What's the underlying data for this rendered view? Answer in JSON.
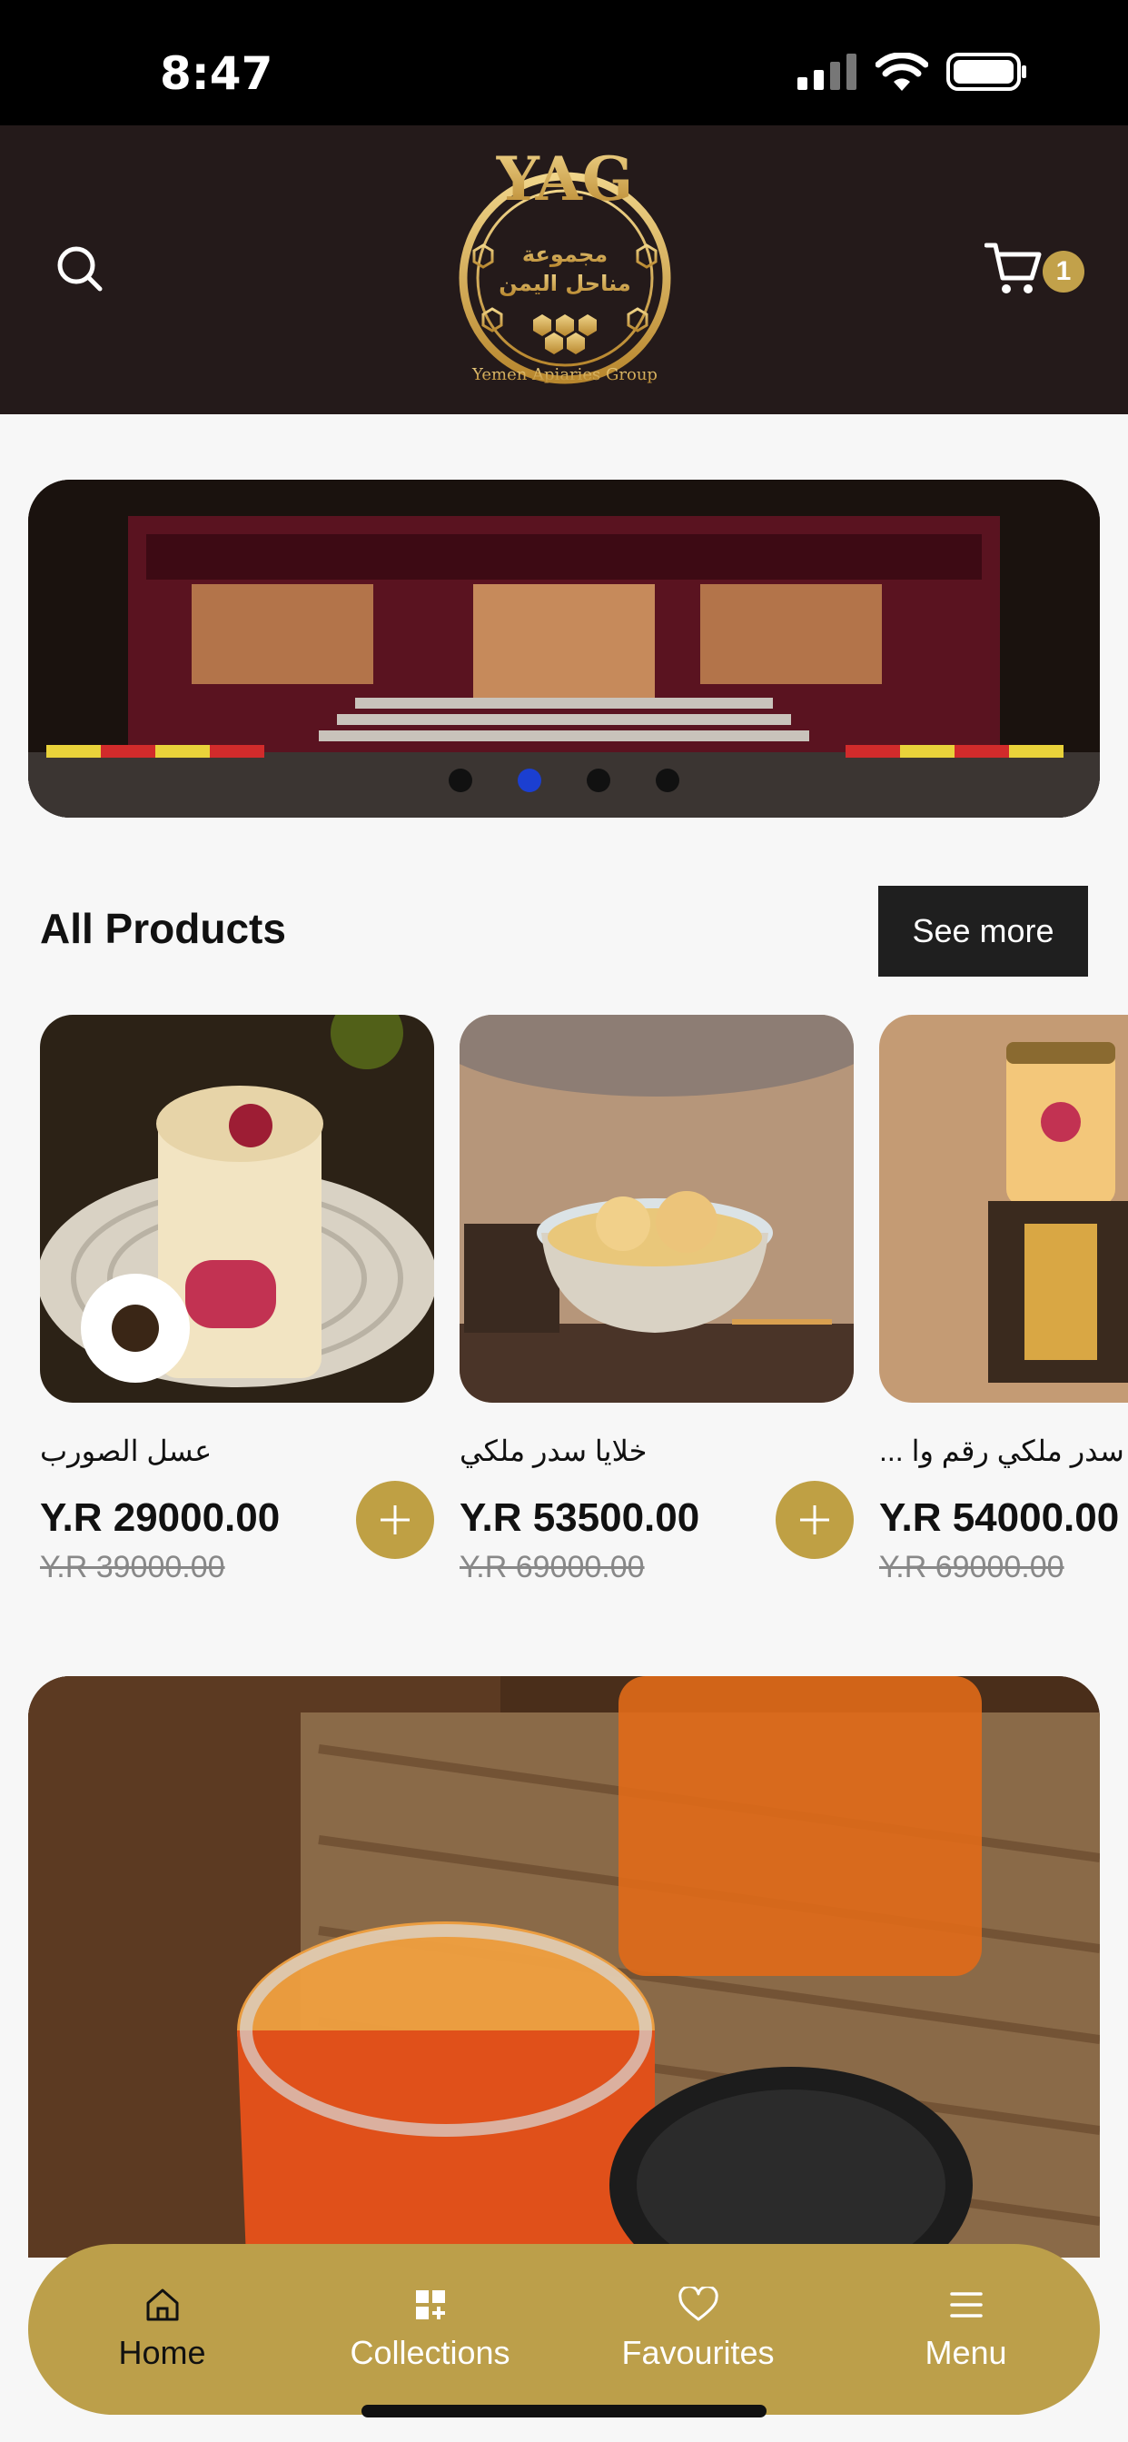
{
  "status_bar": {
    "time": "8:47"
  },
  "header": {
    "cart_count": "1",
    "logo": {
      "mark": "YAG",
      "arabic_line1": "مجموعة",
      "arabic_line2": "مناحل اليمن",
      "english": "Yemen Apiaries Group"
    }
  },
  "hero": {
    "slide_count": 4,
    "active_slide": 2
  },
  "section": {
    "title": "All Products",
    "see_more": "See more"
  },
  "products": [
    {
      "name": "عسل الصورب",
      "price": "Y.R 29000.00",
      "old_price": "Y.R 39000.00"
    },
    {
      "name": "خلايا سدر ملكي",
      "price": "Y.R 53500.00",
      "old_price": "Y.R 69000.00"
    },
    {
      "name": "عسل سدر ملكي رقم وا ...",
      "price": "Y.R 54000.00",
      "old_price": "Y.R 69000.00"
    }
  ],
  "bottom_nav": [
    {
      "label": "Home",
      "icon": "home-icon",
      "active": true
    },
    {
      "label": "Collections",
      "icon": "grid-plus-icon",
      "active": false
    },
    {
      "label": "Favourites",
      "icon": "heart-icon",
      "active": false
    },
    {
      "label": "Menu",
      "icon": "menu-icon",
      "active": false
    }
  ],
  "colors": {
    "header_bg": "#241a1a",
    "gold": "#bfa044",
    "see_more_bg": "#1f1f1f",
    "active_dot": "#1b3fd1"
  }
}
